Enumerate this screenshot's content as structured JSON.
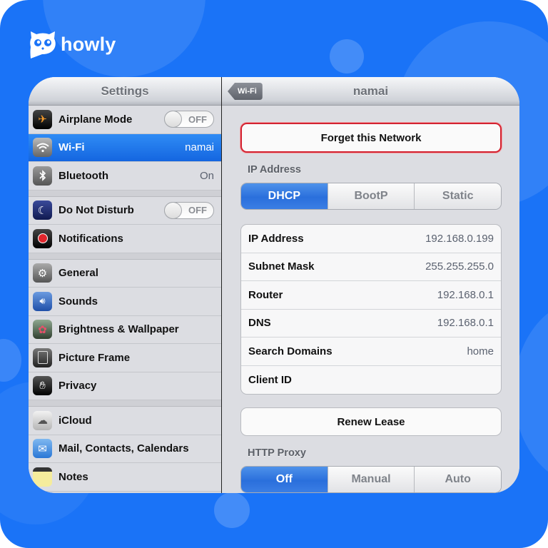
{
  "brand": {
    "name": "howly",
    "icon": "owl-logo-icon"
  },
  "master": {
    "title": "Settings",
    "groups": [
      [
        {
          "label": "Airplane Mode",
          "icon": "airplane-icon",
          "toggle": "OFF"
        },
        {
          "label": "Wi-Fi",
          "icon": "wifi-icon",
          "value": "namai",
          "selected": true
        },
        {
          "label": "Bluetooth",
          "icon": "bluetooth-icon",
          "value": "On"
        }
      ],
      [
        {
          "label": "Do Not Disturb",
          "icon": "moon-icon",
          "toggle": "OFF"
        },
        {
          "label": "Notifications",
          "icon": "notifications-icon"
        }
      ],
      [
        {
          "label": "General",
          "icon": "gear-icon"
        },
        {
          "label": "Sounds",
          "icon": "speaker-icon"
        },
        {
          "label": "Brightness & Wallpaper",
          "icon": "flower-icon"
        },
        {
          "label": "Picture Frame",
          "icon": "picture-frame-icon"
        },
        {
          "label": "Privacy",
          "icon": "hand-icon"
        }
      ],
      [
        {
          "label": "iCloud",
          "icon": "cloud-icon"
        },
        {
          "label": "Mail, Contacts, Calendars",
          "icon": "mail-icon"
        },
        {
          "label": "Notes",
          "icon": "notes-icon"
        }
      ]
    ]
  },
  "detail": {
    "title": "namai",
    "back_label": "Wi-Fi",
    "forget_label": "Forget this Network",
    "ip_section_label": "IP Address",
    "ip_modes": [
      "DHCP",
      "BootP",
      "Static"
    ],
    "ip_mode_selected": "DHCP",
    "rows": [
      {
        "key": "IP Address",
        "value": "192.168.0.199"
      },
      {
        "key": "Subnet Mask",
        "value": "255.255.255.0"
      },
      {
        "key": "Router",
        "value": "192.168.0.1"
      },
      {
        "key": "DNS",
        "value": "192.168.0.1"
      },
      {
        "key": "Search Domains",
        "value": "home"
      },
      {
        "key": "Client ID",
        "value": ""
      }
    ],
    "renew_label": "Renew Lease",
    "proxy_section_label": "HTTP Proxy",
    "proxy_modes": [
      "Off",
      "Manual",
      "Auto"
    ],
    "proxy_mode_selected": "Off"
  },
  "colors": {
    "background": "#1a73f7",
    "selected": "#1466e0",
    "danger": "#d32331"
  }
}
